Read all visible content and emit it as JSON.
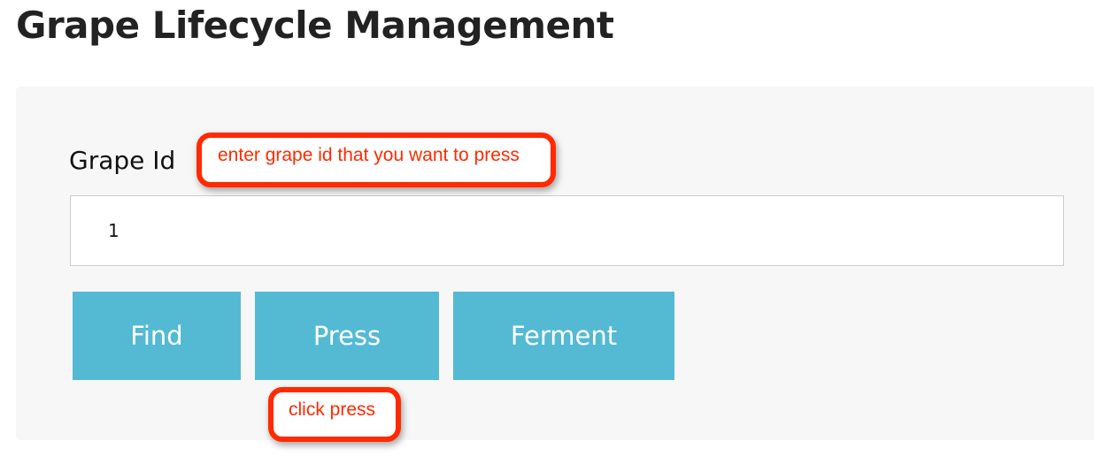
{
  "header": {
    "title": "Grape Lifecycle Management"
  },
  "form": {
    "grape_id_label": "Grape Id",
    "grape_id_value": "1"
  },
  "actions": {
    "find_label": "Find",
    "press_label": "Press",
    "ferment_label": "Ferment"
  },
  "annotations": {
    "grape_id_hint": "enter grape id that you want to press",
    "press_hint": "click press"
  },
  "colors": {
    "button_background": "#54bad3",
    "button_text": "#ffffff",
    "annotation_border": "#ff2a00",
    "panel_background": "#f7f7f7"
  }
}
